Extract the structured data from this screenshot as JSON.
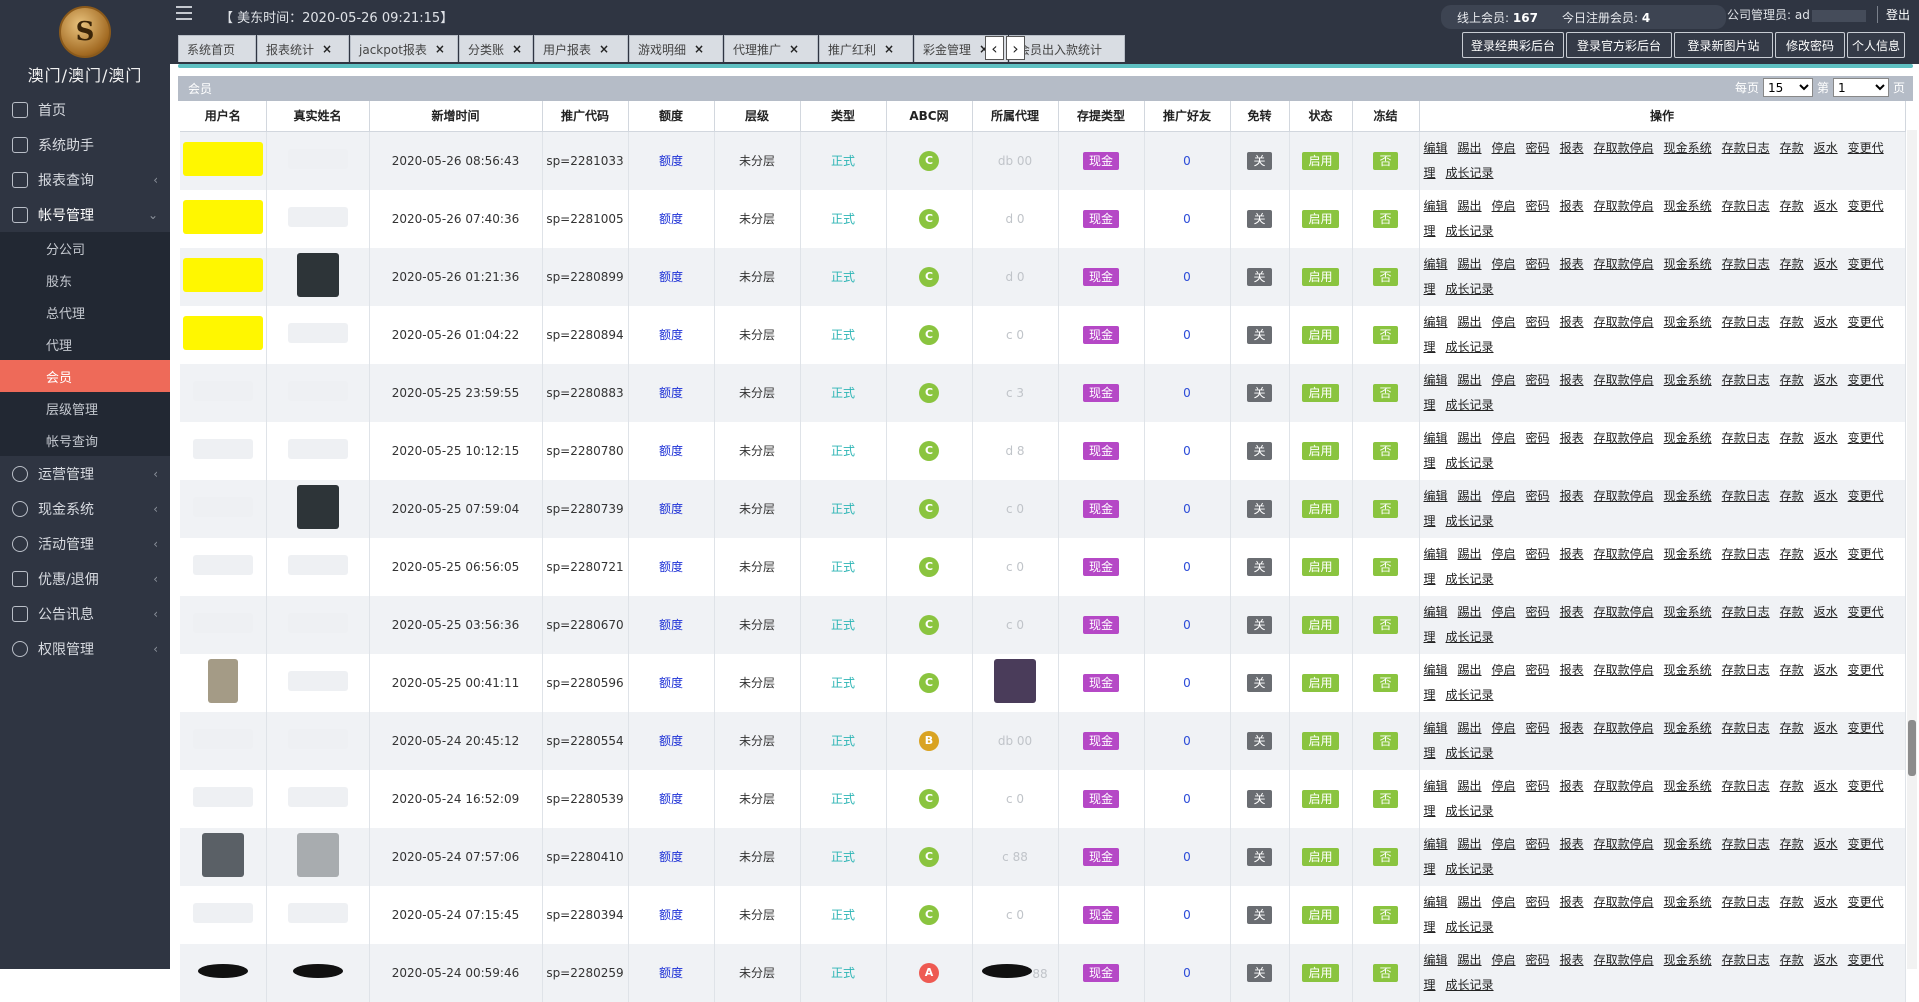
{
  "brand": {
    "name": "澳门/澳门/澳门",
    "emblem_glyph": "S"
  },
  "topbar": {
    "time_text": "【 美东时间：2020-05-26 09:21:15】",
    "online_label": "线上会员:",
    "online_count": "167",
    "today_label": "今日注册会员:",
    "today_count": "4",
    "admin_label": "公司管理员: ad",
    "logout": "登出"
  },
  "sidebar": {
    "items": [
      {
        "label": "首页",
        "icon": "home-icon"
      },
      {
        "label": "系统助手",
        "icon": "home-icon"
      },
      {
        "label": "报表查询",
        "icon": "list-icon"
      },
      {
        "label": "帐号管理",
        "icon": "user-icon"
      },
      {
        "label": "运营管理",
        "icon": "clock-icon"
      },
      {
        "label": "现金系统",
        "icon": "coin-icon"
      },
      {
        "label": "活动管理",
        "icon": "clock-icon"
      },
      {
        "label": "优惠/退佣",
        "icon": "tag-icon"
      },
      {
        "label": "公告讯息",
        "icon": "mail-icon"
      },
      {
        "label": "权限管理",
        "icon": "shield-icon"
      }
    ],
    "sub_items": [
      "分公司",
      "股东",
      "总代理",
      "代理",
      "会员",
      "层级管理",
      "帐号查询"
    ]
  },
  "tabs": [
    "系统首页",
    "报表统计",
    "jackpot报表",
    "分类账",
    "用户报表",
    "游戏明细",
    "代理推广",
    "推广红利",
    "彩金管理",
    "会员出入款统计"
  ],
  "action_buttons": [
    "登录经典彩后台",
    "登录官方彩后台",
    "登录新图片站",
    "修改密码",
    "个人信息"
  ],
  "panel": {
    "title": "会员",
    "per_page_label": "每页",
    "per_page": "15",
    "page_prefix": "第",
    "page": "1",
    "page_suffix": "页"
  },
  "table": {
    "headers": [
      "用户名",
      "真实姓名",
      "新增时间",
      "推广代码",
      "额度",
      "层级",
      "类型",
      "ABC网",
      "所属代理",
      "存提类型",
      "推广好友",
      "免转",
      "状态",
      "冻结",
      "操作"
    ],
    "ops": [
      "编辑",
      "踢出",
      "停启",
      "密码",
      "报表",
      "存取款停启",
      "现金系统",
      "存款日志",
      "存款",
      "返水",
      "变更代理",
      "成长记录"
    ],
    "rows": [
      {
        "time": "2020-05-26 08:56:43",
        "code": "sp=2281033",
        "abc": "C",
        "agent": "db  00"
      },
      {
        "time": "2020-05-26 07:40:36",
        "code": "sp=2281005",
        "abc": "C",
        "agent": "d  0"
      },
      {
        "time": "2020-05-26 01:21:36",
        "code": "sp=2280899",
        "abc": "C",
        "agent": "d  0"
      },
      {
        "time": "2020-05-26 01:04:22",
        "code": "sp=2280894",
        "abc": "C",
        "agent": "c  0"
      },
      {
        "time": "2020-05-25 23:59:55",
        "code": "sp=2280883",
        "abc": "C",
        "agent": "c  3"
      },
      {
        "time": "2020-05-25 10:12:15",
        "code": "sp=2280780",
        "abc": "C",
        "agent": "d  8"
      },
      {
        "time": "2020-05-25 07:59:04",
        "code": "sp=2280739",
        "abc": "C",
        "agent": "c  0"
      },
      {
        "time": "2020-05-25 06:56:05",
        "code": "sp=2280721",
        "abc": "C",
        "agent": "c  0"
      },
      {
        "time": "2020-05-25 03:56:36",
        "code": "sp=2280670",
        "abc": "C",
        "agent": "c  0"
      },
      {
        "time": "2020-05-25 00:41:11",
        "code": "sp=2280596",
        "abc": "C",
        "agent": ""
      },
      {
        "time": "2020-05-24 20:45:12",
        "code": "sp=2280554",
        "abc": "B",
        "agent": "db  00"
      },
      {
        "time": "2020-05-24 16:52:09",
        "code": "sp=2280539",
        "abc": "C",
        "agent": "c  0"
      },
      {
        "time": "2020-05-24 07:57:06",
        "code": "sp=2280410",
        "abc": "C",
        "agent": "c  88"
      },
      {
        "time": "2020-05-24 07:15:45",
        "code": "sp=2280394",
        "abc": "C",
        "agent": "c  0"
      },
      {
        "time": "2020-05-24 00:59:46",
        "code": "sp=2280259",
        "abc": "A",
        "agent": "88"
      }
    ],
    "edu": "额度",
    "level": "未分层",
    "type": "正式",
    "cash": "现金",
    "friends": "0",
    "free": "关",
    "status": "启用",
    "frozen": "否",
    "abc_colors": {
      "A": "#ee5a52",
      "B": "#d9a322",
      "C": "#8ac43f"
    }
  }
}
